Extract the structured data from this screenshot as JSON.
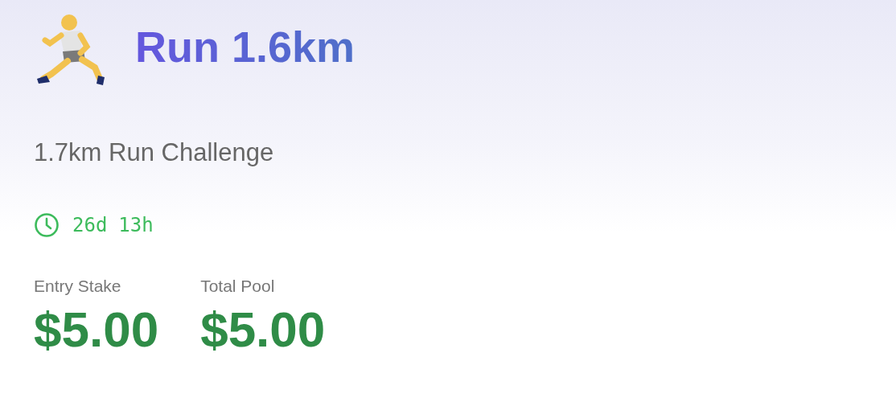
{
  "header": {
    "title": "Run 1.6km"
  },
  "subtitle": "1.7km Run Challenge",
  "time_left": {
    "days": "26d",
    "hours": "13h"
  },
  "stats": [
    {
      "label": "Entry Stake",
      "value": "$5.00"
    },
    {
      "label": "Total Pool",
      "value": "$5.00"
    }
  ]
}
